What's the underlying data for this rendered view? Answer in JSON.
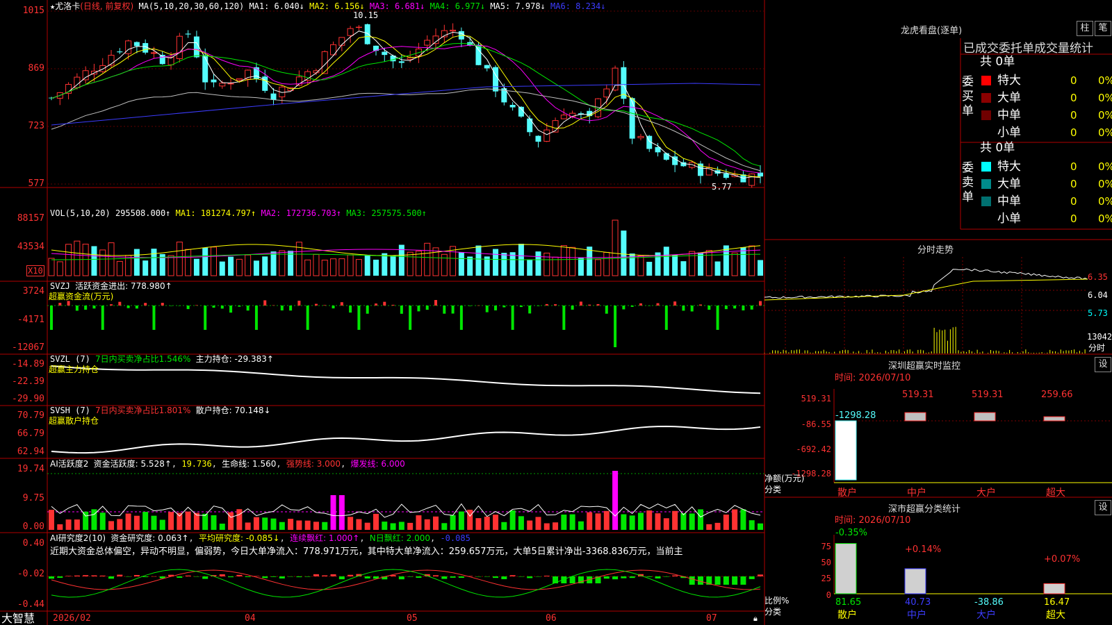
{
  "colors": {
    "up": "#ff3232",
    "down": "#54fcfc",
    "ma1": "#ffffff",
    "ma2": "#ffff00",
    "ma3": "#ff00ff",
    "ma4": "#00e600",
    "ma5": "#c0c0c0",
    "ma6": "#3c3cff",
    "grid": "#a00000"
  },
  "header": {
    "star": "★",
    "name": "尤洛卡",
    "mode": "(日线, 前复权)",
    "ma_label": "MA(5,10,20,30,60,120)"
  },
  "ma_values": [
    {
      "label": "MA1: 6.040↓"
    },
    {
      "label": "MA2: 6.156↓"
    },
    {
      "label": "MA3: 6.681↓"
    },
    {
      "label": "MA4: 6.977↓"
    },
    {
      "label": "MA5: 7.978↓"
    },
    {
      "label": "MA6: 8.234↓"
    }
  ],
  "price_axis": [
    "1015",
    "869",
    "723",
    "577"
  ],
  "price_marks": {
    "high": "10.15",
    "low": "5.77"
  },
  "vol": {
    "label": "VOL(5,10,20)",
    "value": "295508.000↑",
    "ma1": "MA1: 181274.797↑",
    "ma2": "MA2: 172736.703↑",
    "ma3": "MA3: 257575.500↑",
    "axis": [
      "88157",
      "43534"
    ],
    "unit": "X10"
  },
  "svzj": {
    "label": "SVZJ",
    "name": "活跃资金进出: 778.980↑",
    "sub": "超赢资金流(万元)",
    "axis": [
      "3724",
      "-4171",
      "-12067"
    ]
  },
  "svzl": {
    "label": "SVZL (7)",
    "text1": "7日内买卖净占比1.546%",
    "text2": "主力持仓: -29.383↑",
    "sub": "超赢主力持仓",
    "axis": [
      "-14.89",
      "-22.39",
      "-29.90"
    ]
  },
  "svsh": {
    "label": "SVSH (7)",
    "text1": "7日内买卖净占比1.801%",
    "text2": "散户持仓: 70.148↓",
    "sub": "超赢散户持仓",
    "axis": [
      "70.79",
      "66.79",
      "62.94"
    ]
  },
  "ai1": {
    "label": "AI活跃度2",
    "t1": "资金活跃度: 5.528↑",
    "t2": "19.736",
    "t3": "生命线: 1.560",
    "t4": "强势线: 3.000",
    "t5": "爆发线: 6.000",
    "axis": [
      "19.74",
      "9.75",
      "0.00"
    ]
  },
  "ai2": {
    "label": "AI研究度2(10)",
    "t1": "资金研究度: 0.063↑",
    "t2": "平均研究度: -0.085↓",
    "t3": "连续飘红: 1.000↑",
    "t4": "N日飘红: 2.000",
    "t5": "-0.085",
    "axis": [
      "0.40",
      "-0.02",
      "-0.44"
    ],
    "comment": "近期大资金总体偏空，异动不明显，偏弱势，今日大单净流入：778.971万元，其中特大单净流入：259.657万元，大单5日累计净出-3368.836万元，当前主"
  },
  "xaxis": {
    "brand": "大智慧",
    "labels": [
      "2026/02",
      "04",
      "05",
      "06",
      "07"
    ]
  },
  "lhb": {
    "title": "龙虎看盘(逐单)",
    "btn1": "柱",
    "btn2": "笔",
    "heading": "已成交委托单成交量统计",
    "buy": {
      "side": "委买单",
      "total": "共 0单",
      "rows": [
        {
          "name": "特大",
          "count": "0",
          "pct": "0%",
          "color": "#ff0000"
        },
        {
          "name": "大单",
          "count": "0",
          "pct": "0%",
          "color": "#8b0000"
        },
        {
          "name": "中单",
          "count": "0",
          "pct": "0%",
          "color": "#700000"
        },
        {
          "name": "小单",
          "count": "0",
          "pct": "0%",
          "color": "#000000"
        }
      ]
    },
    "sell": {
      "side": "委卖单",
      "total": "共 0单",
      "rows": [
        {
          "name": "特大",
          "count": "0",
          "pct": "0%",
          "color": "#00ffff"
        },
        {
          "name": "大单",
          "count": "0",
          "pct": "0%",
          "color": "#008b8b"
        },
        {
          "name": "中单",
          "count": "0",
          "pct": "0%",
          "color": "#007070"
        },
        {
          "name": "小单",
          "count": "0",
          "pct": "0%",
          "color": "#000000"
        }
      ]
    }
  },
  "intraday": {
    "title": "分时走势",
    "axis": [
      "6.35",
      "6.04",
      "5.73"
    ],
    "vol": "13042",
    "vol_unit": "分时"
  },
  "monitor": {
    "title": "深圳超赢实时监控",
    "btn": "设",
    "time": "时间: 2026/07/10",
    "axis": [
      "519.31",
      "-86.55",
      "-692.42",
      "-1298.28"
    ],
    "ylabel1": "净额(万元)",
    "ylabel2": "分类",
    "bars": [
      {
        "cat": "散户",
        "value": -1298.28,
        "label": "-1298.28"
      },
      {
        "cat": "中户",
        "value": 519.31,
        "label": "519.31"
      },
      {
        "cat": "大户",
        "value": 519.31,
        "label": "519.31"
      },
      {
        "cat": "超大",
        "value": 259.66,
        "label": "259.66"
      }
    ]
  },
  "classify": {
    "title": "深市超赢分类统计",
    "btn": "设",
    "time": "时间: 2026/07/10",
    "axis": [
      "75",
      "50",
      "25",
      "0"
    ],
    "ylabel1": "比例%",
    "ylabel2": "分类",
    "bars": [
      {
        "cat": "散户",
        "ratio": 81.65,
        "top": "-0.35%",
        "bottom": "81.65"
      },
      {
        "cat": "中户",
        "ratio": 40.73,
        "top": "+0.14%",
        "bottom": "40.73"
      },
      {
        "cat": "大户",
        "ratio": 0,
        "top": "",
        "bottom": "-38.86"
      },
      {
        "cat": "超大",
        "ratio": 16.47,
        "top": "+0.07%",
        "bottom": "16.47"
      }
    ]
  }
}
